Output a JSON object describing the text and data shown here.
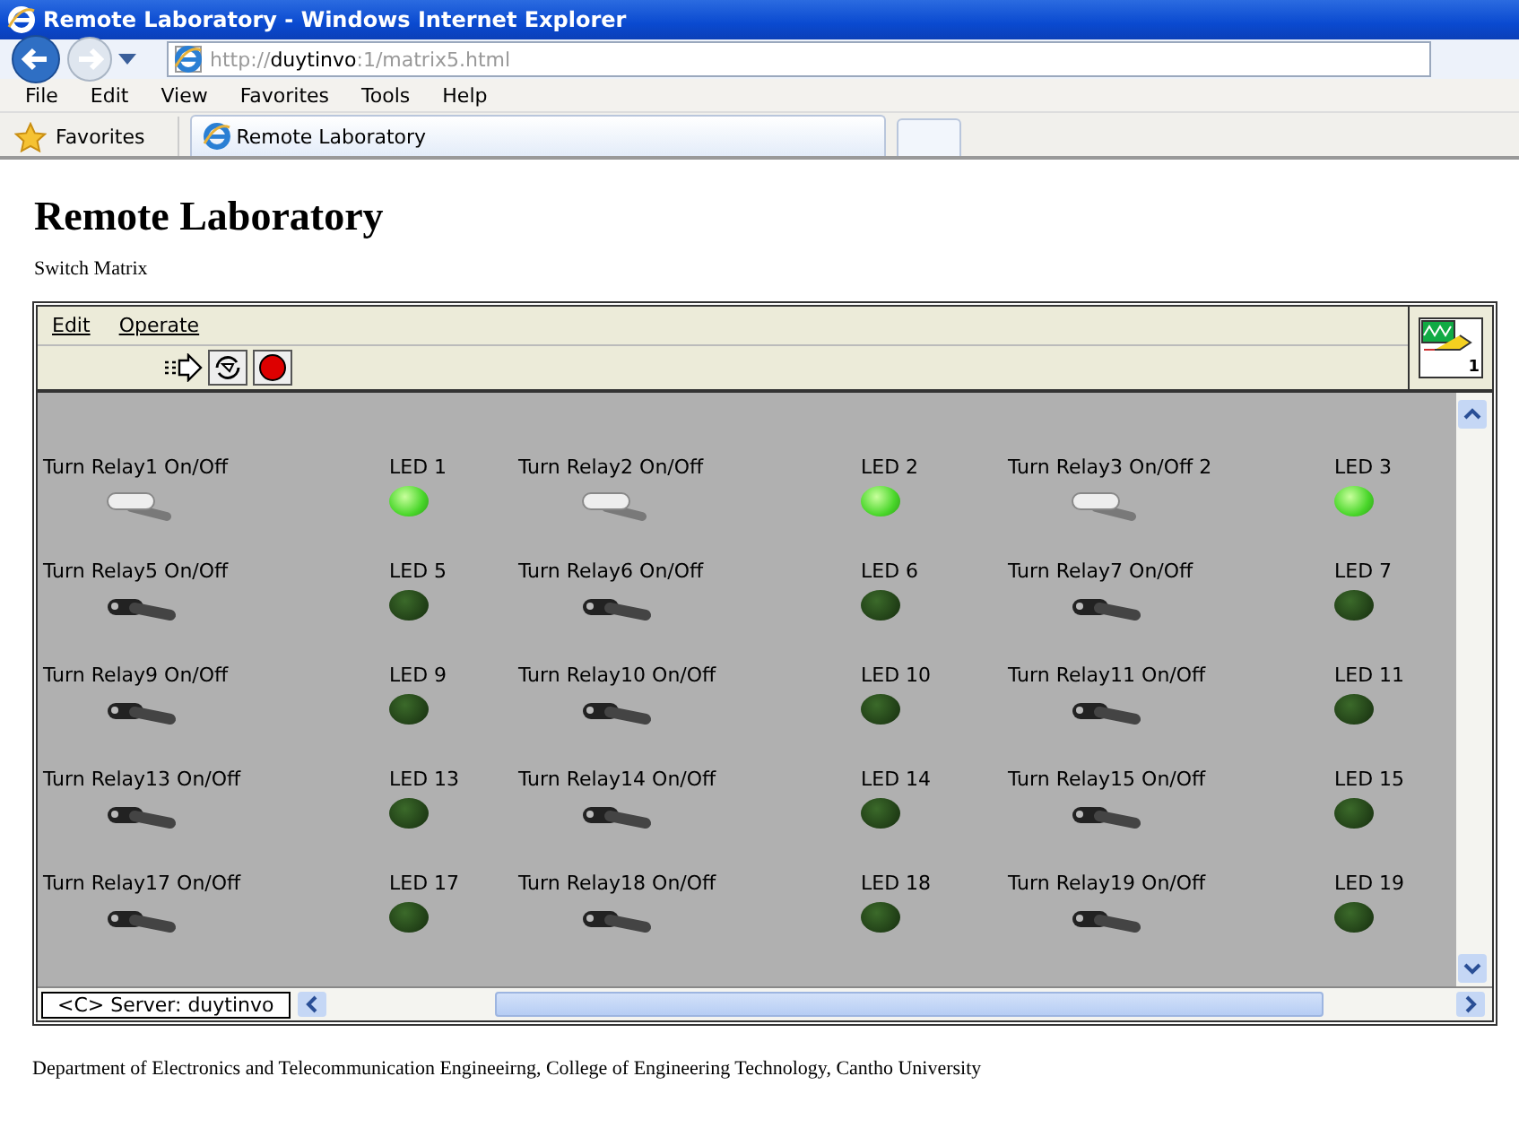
{
  "window": {
    "title": "Remote Laboratory - Windows Internet Explorer"
  },
  "address": {
    "prefix": "http://",
    "host": "duytinvo",
    "rest": ":1/matrix5.html"
  },
  "menu": [
    "File",
    "Edit",
    "View",
    "Favorites",
    "Tools",
    "Help"
  ],
  "favorites_bar": {
    "label": "Favorites",
    "tabs": [
      {
        "label": "Remote Laboratory",
        "selected": true
      }
    ]
  },
  "page": {
    "heading": "Remote Laboratory",
    "subtitle": "Switch Matrix",
    "vi": {
      "menu": [
        "Edit",
        "Operate"
      ],
      "icon_number": "1",
      "units": [
        {
          "switch_label": "Turn Relay1 On/Off",
          "switch_on": true,
          "led_label": "LED 1",
          "led_on": true
        },
        {
          "switch_label": "Turn Relay2 On/Off",
          "switch_on": true,
          "led_label": "LED 2",
          "led_on": true
        },
        {
          "switch_label": "Turn Relay3 On/Off 2",
          "switch_on": true,
          "led_label": "LED 3",
          "led_on": true
        },
        {
          "switch_label": "Turn Relay5 On/Off",
          "switch_on": false,
          "led_label": "LED 5",
          "led_on": false
        },
        {
          "switch_label": "Turn Relay6 On/Off",
          "switch_on": false,
          "led_label": "LED 6",
          "led_on": false
        },
        {
          "switch_label": "Turn Relay7 On/Off",
          "switch_on": false,
          "led_label": "LED 7",
          "led_on": false
        },
        {
          "switch_label": "Turn Relay9 On/Off",
          "switch_on": false,
          "led_label": "LED 9",
          "led_on": false
        },
        {
          "switch_label": "Turn Relay10 On/Off",
          "switch_on": false,
          "led_label": "LED 10",
          "led_on": false
        },
        {
          "switch_label": "Turn Relay11 On/Off",
          "switch_on": false,
          "led_label": "LED 11",
          "led_on": false
        },
        {
          "switch_label": "Turn Relay13 On/Off",
          "switch_on": false,
          "led_label": "LED 13",
          "led_on": false
        },
        {
          "switch_label": "Turn Relay14 On/Off",
          "switch_on": false,
          "led_label": "LED 14",
          "led_on": false
        },
        {
          "switch_label": "Turn Relay15 On/Off",
          "switch_on": false,
          "led_label": "LED 15",
          "led_on": false
        },
        {
          "switch_label": "Turn Relay17 On/Off",
          "switch_on": false,
          "led_label": "LED 17",
          "led_on": false
        },
        {
          "switch_label": "Turn Relay18 On/Off",
          "switch_on": false,
          "led_label": "LED 18",
          "led_on": false
        },
        {
          "switch_label": "Turn Relay19 On/Off",
          "switch_on": false,
          "led_label": "LED 19",
          "led_on": false
        }
      ],
      "status": "<C> Server: duytinvo"
    },
    "footer": "Department of Electronics and Telecommunication Engineeirng, College of Engineering Technology, Cantho University"
  }
}
